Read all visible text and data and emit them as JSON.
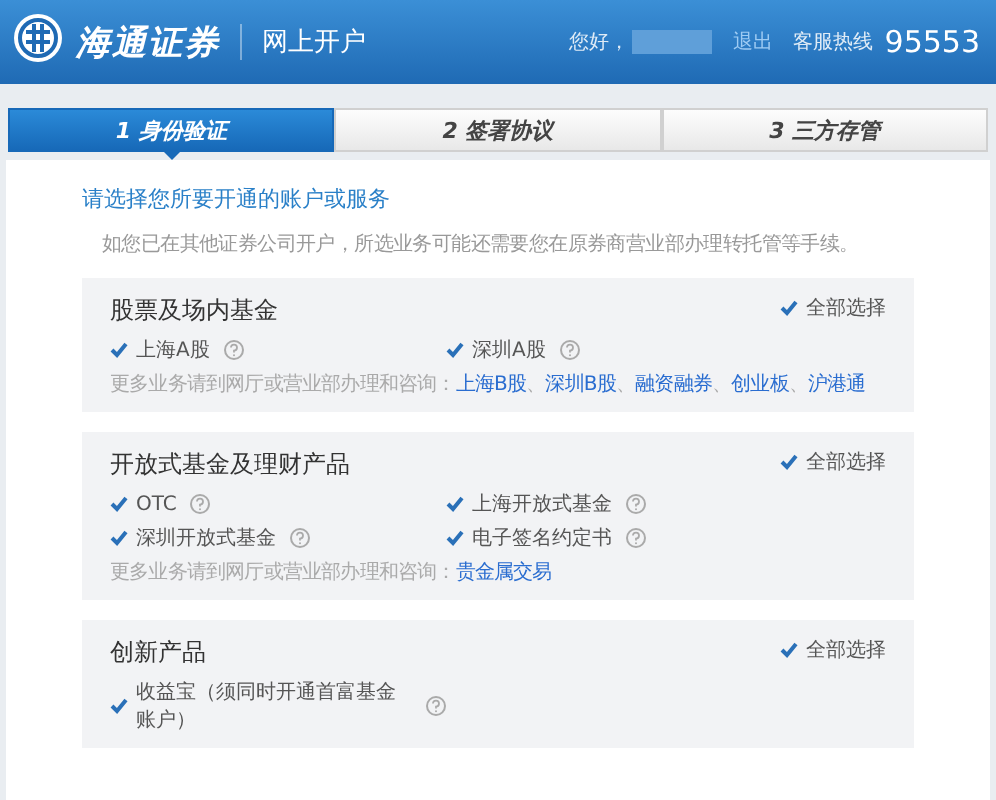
{
  "header": {
    "brand": "海通证券",
    "title": "网上开户",
    "greeting": "您好，",
    "logout": "退出",
    "hotline_label": "客服热线",
    "hotline": "95553"
  },
  "tabs": [
    {
      "label": "1 身份验证",
      "selected": true
    },
    {
      "label": "2 签署协议",
      "selected": false
    },
    {
      "label": "3 三方存管",
      "selected": false
    }
  ],
  "prompt": "请选择您所要开通的账户或服务",
  "note": "如您已在其他证券公司开户，所选业务可能还需要您在原券商营业部办理转托管等手续。",
  "sections": [
    {
      "title": "股票及场内基金",
      "select_all": {
        "label": "全部选择",
        "checked": true
      },
      "items": [
        {
          "label": "上海A股",
          "checked": true
        },
        {
          "label": "深圳A股",
          "checked": true
        }
      ],
      "more_label": "更多业务请到网厅或营业部办理和咨询：",
      "more_links": [
        "上海B股",
        "深圳B股",
        "融资融券",
        "创业板",
        "沪港通"
      ],
      "separator": "、"
    },
    {
      "title": "开放式基金及理财产品",
      "select_all": {
        "label": "全部选择",
        "checked": true
      },
      "items": [
        {
          "label": "OTC",
          "checked": true
        },
        {
          "label": "上海开放式基金",
          "checked": true
        },
        {
          "label": "深圳开放式基金",
          "checked": true
        },
        {
          "label": "电子签名约定书",
          "checked": true
        }
      ],
      "more_label": "更多业务请到网厅或营业部办理和咨询：",
      "more_links": [
        "贵金属交易"
      ]
    },
    {
      "title": "创新产品",
      "select_all": {
        "label": "全部选择",
        "checked": true
      },
      "items": [
        {
          "label": "收益宝（须同时开通首富基金账户）",
          "checked": true
        }
      ]
    }
  ]
}
